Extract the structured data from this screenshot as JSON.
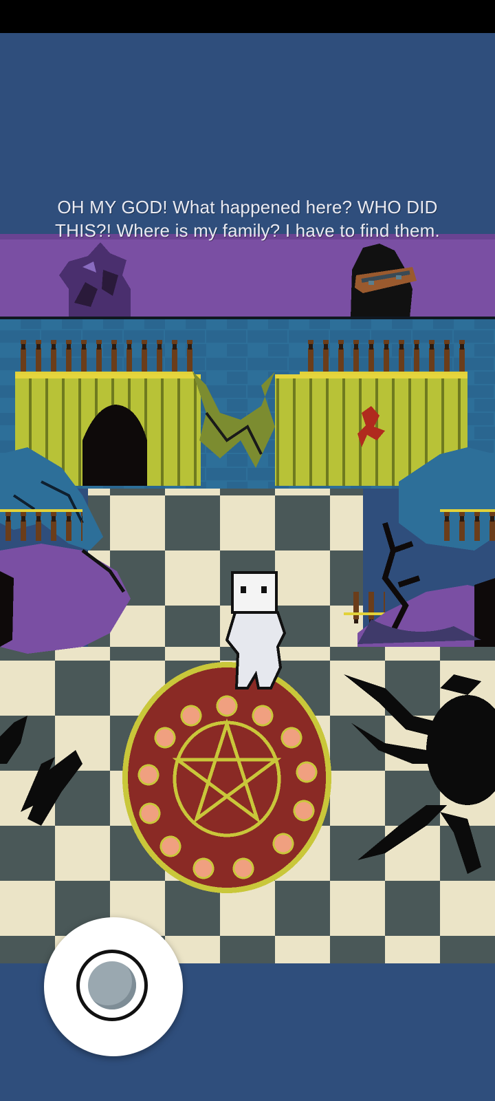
{
  "dialogue": {
    "line1": "OH MY GOD! What happened here? WHO DID",
    "line2": "THIS?! Where is my family? I have to find them."
  },
  "colors": {
    "sky": "#2f4e7c",
    "purple_wall": "#7a4fa3",
    "hedge_yellow": "#b8c237",
    "floor_light": "#ebe4c7",
    "floor_dark": "#4a5858",
    "rug_red": "#8a2a25",
    "rug_trim": "#c9c73a"
  },
  "icons": {
    "joystick": "virtual-joystick-icon",
    "pentagram": "pentagram-icon",
    "player": "ghost-child-sprite"
  }
}
